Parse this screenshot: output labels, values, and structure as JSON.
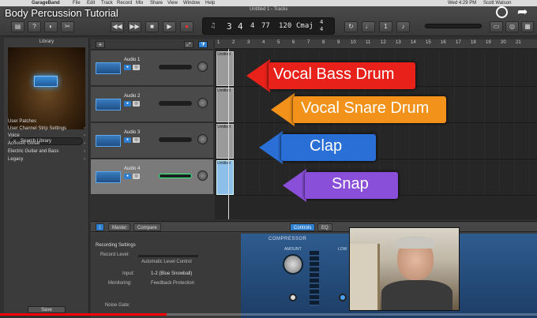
{
  "menubar": {
    "app": "GarageBand",
    "items": [
      "File",
      "Edit",
      "Track",
      "Record",
      "Mix",
      "Share",
      "View",
      "Window",
      "Help"
    ],
    "clock": "Wed 4:29 PM",
    "user": "Scott Watson"
  },
  "video": {
    "title": "Body Percussion Tutorial",
    "progress": 0.31
  },
  "window": {
    "title": "Untitled 1 - Tracks"
  },
  "lcd": {
    "bar": "3",
    "beat": "4",
    "div": "4",
    "tick": "77",
    "tempo": "120",
    "key": "Cmaj",
    "sig_top": "4",
    "sig_bottom": "4"
  },
  "library": {
    "title": "Library",
    "search_placeholder": "Search Library",
    "items": [
      "User Patches",
      "User Channel Strip Settings",
      "Voice",
      "Acoustic Guitar",
      "Electric Guitar and Bass",
      "Legacy"
    ],
    "save_label": "Save"
  },
  "tracks": [
    {
      "name": "Audio 1",
      "region": "Untitled"
    },
    {
      "name": "Audio 2",
      "region": "Untitled"
    },
    {
      "name": "Audio 3",
      "region": "Untitled"
    },
    {
      "name": "Audio 4",
      "region": "Untitled"
    }
  ],
  "ruler": {
    "marks": [
      "1",
      "2",
      "3",
      "4",
      "5",
      "6",
      "7",
      "8",
      "9",
      "10",
      "11",
      "12",
      "13",
      "14",
      "15",
      "16",
      "17",
      "18",
      "19",
      "20",
      "21"
    ]
  },
  "annotations": [
    {
      "label": "Vocal Bass Drum",
      "color": "#e8211a"
    },
    {
      "label": "Vocal Snare Drum",
      "color": "#f2921a"
    },
    {
      "label": "Clap",
      "color": "#2a6fd6"
    },
    {
      "label": "Snap",
      "color": "#8a4fd8"
    }
  ],
  "bottom": {
    "tabs": [
      "Master",
      "Compare"
    ],
    "right_tabs": [
      "Controls",
      "EQ"
    ],
    "section": "Recording Settings",
    "rows": [
      "Record Level:",
      "Automatic Level Control",
      "Input:",
      "1-2 (Blue Snowball)",
      "Monitoring:",
      "Feedback Protection",
      "Noise Gate:"
    ],
    "plugin": "COMPRESSOR",
    "amount_label": "AMOUNT",
    "low_label": "LOW"
  }
}
